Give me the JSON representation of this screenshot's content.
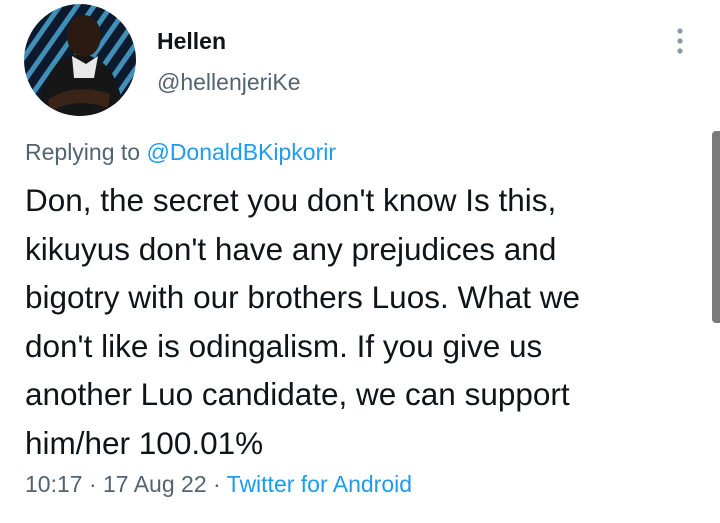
{
  "author": {
    "display_name": "Hellen",
    "handle": "@hellenjeriKe",
    "avatar_icon": "profile-photo-avatar"
  },
  "menu": {
    "icon": "more-vertical-icon"
  },
  "reply": {
    "prefix": "Replying to",
    "mention": "@DonaldBKipkorir"
  },
  "tweet": {
    "lines": [
      "Don, the secret you don't know Is this,",
      "kikuyus don't have any prejudices and",
      "bigotry with our brothers Luos. What we",
      "don't like is odingalism. If you give us",
      "another Luo candidate, we can support",
      "him/her 100.01%"
    ]
  },
  "meta": {
    "time": "10:17",
    "separator": "·",
    "date": "17 Aug 22",
    "source": "Twitter for Android"
  },
  "colors": {
    "text": "#0f1419",
    "secondary": "#536471",
    "link": "#1d9bf0"
  }
}
